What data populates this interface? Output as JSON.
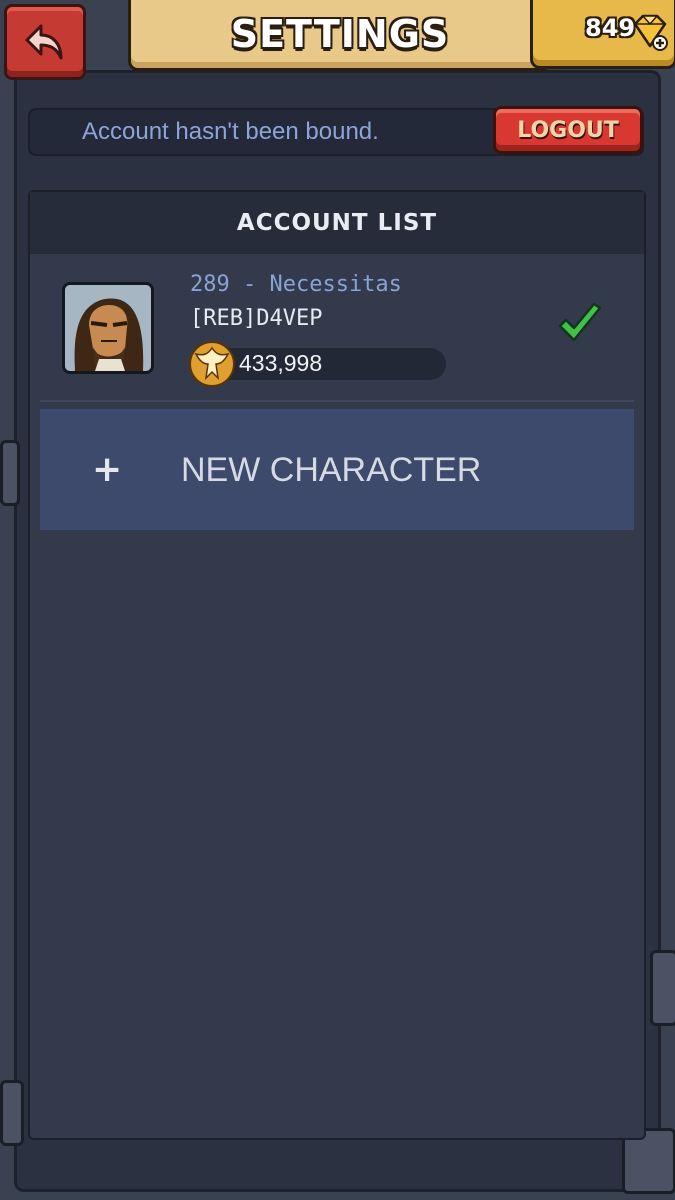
{
  "header": {
    "title": "SETTINGS",
    "back_icon": "back-arrow-icon",
    "currency": {
      "count": "849",
      "icon": "gem-plus-icon"
    }
  },
  "account": {
    "status": "Account hasn't been bound.",
    "logout_label": "LOGOUT"
  },
  "account_list": {
    "title": "ACCOUNT LIST",
    "characters": [
      {
        "server": "289 - Necessitas",
        "name": "[REB]D4VEP",
        "power": "433,998",
        "selected": true
      }
    ],
    "new_character_label": "NEW CHARACTER"
  },
  "colors": {
    "accent_red": "#d8382f",
    "gold": "#e6b94a",
    "parchment": "#e8c98a",
    "panel": "#323a4c",
    "check_green": "#3ec24a",
    "link_blue": "#8aa2d4"
  }
}
